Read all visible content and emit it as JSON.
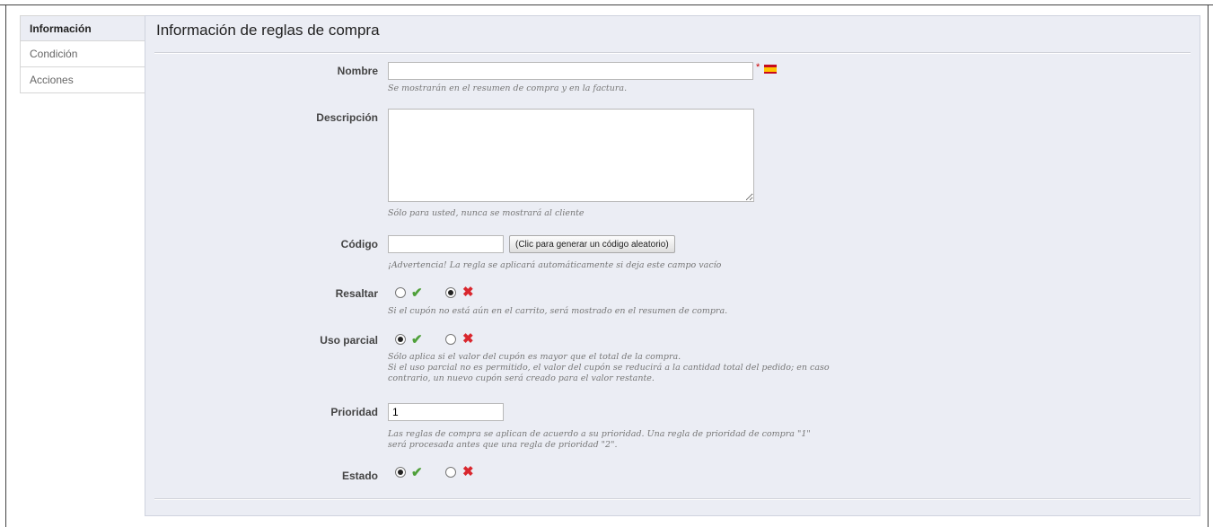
{
  "tabs": [
    {
      "label": "Información"
    },
    {
      "label": "Condición"
    },
    {
      "label": "Acciones"
    }
  ],
  "panel": {
    "title": "Información de reglas de compra"
  },
  "form": {
    "name": {
      "label": "Nombre",
      "value": "",
      "required_mark": "*",
      "hint": "Se mostrarán en el resumen de compra y en la factura."
    },
    "description": {
      "label": "Descripción",
      "value": "",
      "hint": "Sólo para usted, nunca se mostrará al cliente"
    },
    "code": {
      "label": "Código",
      "value": "",
      "button_label": "(Clic para generar un código aleatorio)",
      "hint": "¡Advertencia! La regla se aplicará automáticamente si deja este campo vacío"
    },
    "highlight": {
      "label": "Resaltar",
      "selected": "no",
      "hint": "Si el cupón no está aún en el carrito, será mostrado en el resumen de compra."
    },
    "partial_use": {
      "label": "Uso parcial",
      "selected": "yes",
      "hint_line1": "Sólo aplica si el valor del cupón es mayor que el total de la compra.",
      "hint_line2": "Si el uso parcial no es permitido, el valor del cupón se reducirá a la cantidad total del pedido; en caso",
      "hint_line3": "contrario, un nuevo cupón será creado para el valor restante."
    },
    "priority": {
      "label": "Prioridad",
      "value": "1",
      "hint_line1": "Las reglas de compra se aplican de acuerdo a su prioridad. Una regla de prioridad de compra \"1\"",
      "hint_line2": "será procesada antes que una regla de prioridad \"2\"."
    },
    "status": {
      "label": "Estado",
      "selected": "yes"
    }
  },
  "icons": {
    "yes": "check-icon",
    "no": "cross-icon",
    "language": "spain-flag-icon"
  },
  "colors": {
    "panel_bg": "#ebedf4",
    "yes": "#4fa03a",
    "no": "#d9272e"
  }
}
